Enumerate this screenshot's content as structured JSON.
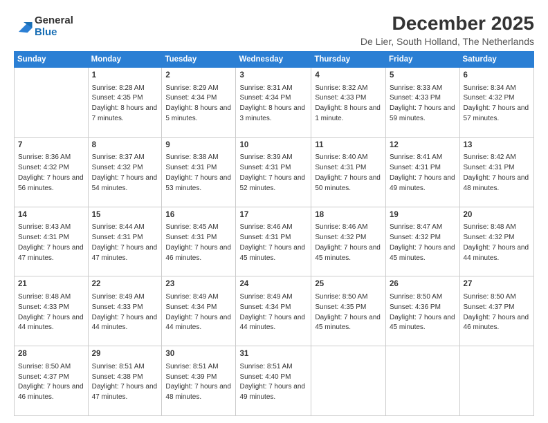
{
  "logo": {
    "general": "General",
    "blue": "Blue"
  },
  "title": "December 2025",
  "subtitle": "De Lier, South Holland, The Netherlands",
  "headers": [
    "Sunday",
    "Monday",
    "Tuesday",
    "Wednesday",
    "Thursday",
    "Friday",
    "Saturday"
  ],
  "weeks": [
    [
      {
        "day": "",
        "sunrise": "",
        "sunset": "",
        "daylight": ""
      },
      {
        "day": "1",
        "sunrise": "Sunrise: 8:28 AM",
        "sunset": "Sunset: 4:35 PM",
        "daylight": "Daylight: 8 hours and 7 minutes."
      },
      {
        "day": "2",
        "sunrise": "Sunrise: 8:29 AM",
        "sunset": "Sunset: 4:34 PM",
        "daylight": "Daylight: 8 hours and 5 minutes."
      },
      {
        "day": "3",
        "sunrise": "Sunrise: 8:31 AM",
        "sunset": "Sunset: 4:34 PM",
        "daylight": "Daylight: 8 hours and 3 minutes."
      },
      {
        "day": "4",
        "sunrise": "Sunrise: 8:32 AM",
        "sunset": "Sunset: 4:33 PM",
        "daylight": "Daylight: 8 hours and 1 minute."
      },
      {
        "day": "5",
        "sunrise": "Sunrise: 8:33 AM",
        "sunset": "Sunset: 4:33 PM",
        "daylight": "Daylight: 7 hours and 59 minutes."
      },
      {
        "day": "6",
        "sunrise": "Sunrise: 8:34 AM",
        "sunset": "Sunset: 4:32 PM",
        "daylight": "Daylight: 7 hours and 57 minutes."
      }
    ],
    [
      {
        "day": "7",
        "sunrise": "Sunrise: 8:36 AM",
        "sunset": "Sunset: 4:32 PM",
        "daylight": "Daylight: 7 hours and 56 minutes."
      },
      {
        "day": "8",
        "sunrise": "Sunrise: 8:37 AM",
        "sunset": "Sunset: 4:32 PM",
        "daylight": "Daylight: 7 hours and 54 minutes."
      },
      {
        "day": "9",
        "sunrise": "Sunrise: 8:38 AM",
        "sunset": "Sunset: 4:31 PM",
        "daylight": "Daylight: 7 hours and 53 minutes."
      },
      {
        "day": "10",
        "sunrise": "Sunrise: 8:39 AM",
        "sunset": "Sunset: 4:31 PM",
        "daylight": "Daylight: 7 hours and 52 minutes."
      },
      {
        "day": "11",
        "sunrise": "Sunrise: 8:40 AM",
        "sunset": "Sunset: 4:31 PM",
        "daylight": "Daylight: 7 hours and 50 minutes."
      },
      {
        "day": "12",
        "sunrise": "Sunrise: 8:41 AM",
        "sunset": "Sunset: 4:31 PM",
        "daylight": "Daylight: 7 hours and 49 minutes."
      },
      {
        "day": "13",
        "sunrise": "Sunrise: 8:42 AM",
        "sunset": "Sunset: 4:31 PM",
        "daylight": "Daylight: 7 hours and 48 minutes."
      }
    ],
    [
      {
        "day": "14",
        "sunrise": "Sunrise: 8:43 AM",
        "sunset": "Sunset: 4:31 PM",
        "daylight": "Daylight: 7 hours and 47 minutes."
      },
      {
        "day": "15",
        "sunrise": "Sunrise: 8:44 AM",
        "sunset": "Sunset: 4:31 PM",
        "daylight": "Daylight: 7 hours and 47 minutes."
      },
      {
        "day": "16",
        "sunrise": "Sunrise: 8:45 AM",
        "sunset": "Sunset: 4:31 PM",
        "daylight": "Daylight: 7 hours and 46 minutes."
      },
      {
        "day": "17",
        "sunrise": "Sunrise: 8:46 AM",
        "sunset": "Sunset: 4:31 PM",
        "daylight": "Daylight: 7 hours and 45 minutes."
      },
      {
        "day": "18",
        "sunrise": "Sunrise: 8:46 AM",
        "sunset": "Sunset: 4:32 PM",
        "daylight": "Daylight: 7 hours and 45 minutes."
      },
      {
        "day": "19",
        "sunrise": "Sunrise: 8:47 AM",
        "sunset": "Sunset: 4:32 PM",
        "daylight": "Daylight: 7 hours and 45 minutes."
      },
      {
        "day": "20",
        "sunrise": "Sunrise: 8:48 AM",
        "sunset": "Sunset: 4:32 PM",
        "daylight": "Daylight: 7 hours and 44 minutes."
      }
    ],
    [
      {
        "day": "21",
        "sunrise": "Sunrise: 8:48 AM",
        "sunset": "Sunset: 4:33 PM",
        "daylight": "Daylight: 7 hours and 44 minutes."
      },
      {
        "day": "22",
        "sunrise": "Sunrise: 8:49 AM",
        "sunset": "Sunset: 4:33 PM",
        "daylight": "Daylight: 7 hours and 44 minutes."
      },
      {
        "day": "23",
        "sunrise": "Sunrise: 8:49 AM",
        "sunset": "Sunset: 4:34 PM",
        "daylight": "Daylight: 7 hours and 44 minutes."
      },
      {
        "day": "24",
        "sunrise": "Sunrise: 8:49 AM",
        "sunset": "Sunset: 4:34 PM",
        "daylight": "Daylight: 7 hours and 44 minutes."
      },
      {
        "day": "25",
        "sunrise": "Sunrise: 8:50 AM",
        "sunset": "Sunset: 4:35 PM",
        "daylight": "Daylight: 7 hours and 45 minutes."
      },
      {
        "day": "26",
        "sunrise": "Sunrise: 8:50 AM",
        "sunset": "Sunset: 4:36 PM",
        "daylight": "Daylight: 7 hours and 45 minutes."
      },
      {
        "day": "27",
        "sunrise": "Sunrise: 8:50 AM",
        "sunset": "Sunset: 4:37 PM",
        "daylight": "Daylight: 7 hours and 46 minutes."
      }
    ],
    [
      {
        "day": "28",
        "sunrise": "Sunrise: 8:50 AM",
        "sunset": "Sunset: 4:37 PM",
        "daylight": "Daylight: 7 hours and 46 minutes."
      },
      {
        "day": "29",
        "sunrise": "Sunrise: 8:51 AM",
        "sunset": "Sunset: 4:38 PM",
        "daylight": "Daylight: 7 hours and 47 minutes."
      },
      {
        "day": "30",
        "sunrise": "Sunrise: 8:51 AM",
        "sunset": "Sunset: 4:39 PM",
        "daylight": "Daylight: 7 hours and 48 minutes."
      },
      {
        "day": "31",
        "sunrise": "Sunrise: 8:51 AM",
        "sunset": "Sunset: 4:40 PM",
        "daylight": "Daylight: 7 hours and 49 minutes."
      },
      {
        "day": "",
        "sunrise": "",
        "sunset": "",
        "daylight": ""
      },
      {
        "day": "",
        "sunrise": "",
        "sunset": "",
        "daylight": ""
      },
      {
        "day": "",
        "sunrise": "",
        "sunset": "",
        "daylight": ""
      }
    ]
  ]
}
